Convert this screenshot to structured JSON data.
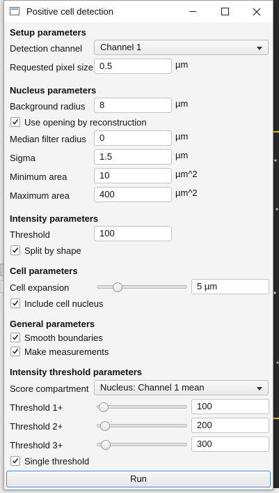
{
  "window": {
    "title": "Positive cell detection"
  },
  "setup": {
    "header": "Setup parameters",
    "detection_channel_label": "Detection channel",
    "detection_channel_value": "Channel 1",
    "pixel_size_label": "Requested pixel size",
    "pixel_size_value": "0.5",
    "pixel_size_unit": "µm"
  },
  "nucleus": {
    "header": "Nucleus parameters",
    "background_radius_label": "Background radius",
    "background_radius_value": "8",
    "background_radius_unit": "µm",
    "opening_label": "Use opening by reconstruction",
    "opening_checked": true,
    "median_label": "Median filter radius",
    "median_value": "0",
    "median_unit": "µm",
    "sigma_label": "Sigma",
    "sigma_value": "1.5",
    "sigma_unit": "µm",
    "min_area_label": "Minimum area",
    "min_area_value": "10",
    "min_area_unit": "µm^2",
    "max_area_label": "Maximum area",
    "max_area_value": "400",
    "max_area_unit": "µm^2"
  },
  "intensity": {
    "header": "Intensity parameters",
    "threshold_label": "Threshold",
    "threshold_value": "100",
    "split_label": "Split by shape",
    "split_checked": true
  },
  "cell": {
    "header": "Cell parameters",
    "expansion_label": "Cell expansion",
    "expansion_value": "5 µm",
    "expansion_slider_fraction": 0.2,
    "include_nucleus_label": "Include cell nucleus",
    "include_nucleus_checked": true
  },
  "general": {
    "header": "General parameters",
    "smooth_label": "Smooth boundaries",
    "smooth_checked": true,
    "measure_label": "Make measurements",
    "measure_checked": true
  },
  "threshold_params": {
    "header": "Intensity threshold parameters",
    "score_label": "Score compartment",
    "score_value": "Nucleus: Channel 1 mean",
    "t1_label": "Threshold 1+",
    "t1_value": "100",
    "t1_slider_fraction": 0.03,
    "t2_label": "Threshold 2+",
    "t2_value": "200",
    "t2_slider_fraction": 0.04,
    "t3_label": "Threshold 3+",
    "t3_value": "300",
    "t3_slider_fraction": 0.05,
    "single_label": "Single threshold",
    "single_checked": true
  },
  "run_label": "Run"
}
